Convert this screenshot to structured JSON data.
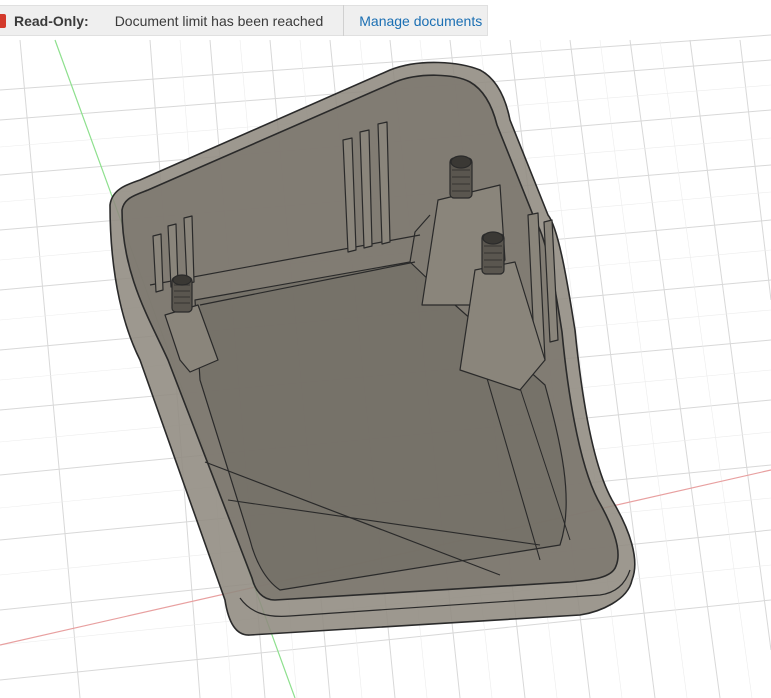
{
  "banner": {
    "status_label": "Read-Only:",
    "message": "Document limit has been reached",
    "link_label": "Manage documents"
  },
  "viewport": {
    "background": "#ffffff",
    "grid_color": "#d6d6d6",
    "axis_x_color": "#e8a0a0",
    "axis_y_color": "#8ee08e",
    "model_color": "#8b8378"
  }
}
